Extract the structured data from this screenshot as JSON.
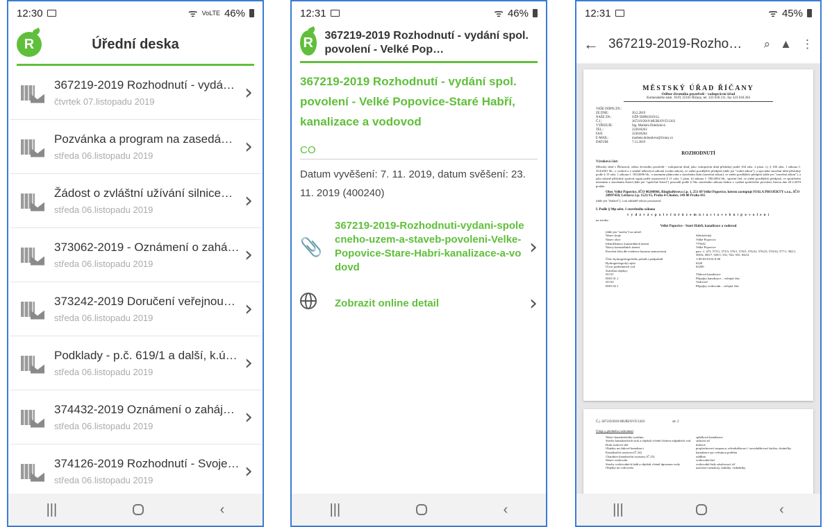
{
  "phone1": {
    "status": {
      "time": "12:30",
      "battery": "46%",
      "signal": "VoLTE"
    },
    "header_title": "Úřední deska",
    "logo_letter": "R",
    "items": [
      {
        "title": "367219-2019 Rozhodnutí - vydá…",
        "date": "čtvrtek 07.listopadu 2019"
      },
      {
        "title": "Pozvánka a program na zasedá…",
        "date": "středa 06.listopadu 2019"
      },
      {
        "title": "Žádost o zvláštní užívání silnice…",
        "date": "středa 06.listopadu 2019"
      },
      {
        "title": "373062-2019 - Oznámení o zahá…",
        "date": "středa 06.listopadu 2019"
      },
      {
        "title": "373242-2019 Doručení veřejnou…",
        "date": "středa 06.listopadu 2019"
      },
      {
        "title": "Podklady - p.č. 619/1 a další, k.ú…",
        "date": "středa 06.listopadu 2019"
      },
      {
        "title": "374432-2019 Oznámení o zaháj…",
        "date": "středa 06.listopadu 2019"
      },
      {
        "title": "374126-2019 Rozhodnutí - Svoje…",
        "date": "středa 06.listopadu 2019"
      }
    ]
  },
  "phone2": {
    "status": {
      "time": "12:31",
      "battery": "46%"
    },
    "logo_letter": "R",
    "header_title": "367219-2019 Rozhodnutí - vydání spol. povolení - Velké Pop…",
    "doc_title": "367219-2019 Rozhodnutí - vydání spol. povolení - Velké Popovice-Staré Habří, kanalizace a vodovod",
    "section_label": "CO",
    "dates_text": "Datum vyvěšení: 7. 11. 2019, datum svěšení: 23. 11. 2019  (400240)",
    "attachment": "367219-2019-Rozhodnuti-vydani-spolecneho-uzem-a-staveb-povoleni-Velke-Popovice-Stare-Habri-kanalizace-a-vodovd",
    "online_detail": "Zobrazit online detail"
  },
  "phone3": {
    "status": {
      "time": "12:31",
      "battery": "45%"
    },
    "title": "367219-2019-Rozho…",
    "doc": {
      "office": "MĚSTSKÝ ÚŘAD ŘÍČANY",
      "department": "Odbor životního prostředí - vodoprávní úřad",
      "address": "Komenského nám. 1619, 25101 Říčany, tel. 323 618 211, fax 323 618 264",
      "meta": [
        [
          "VAŠE DOPIS ZN.:",
          ""
        ],
        [
          "ZE DNE:",
          "20.2.2019"
        ],
        [
          "NAŠE ZN.:",
          "OŽP-50898/2019-Li"
        ],
        [
          "Č.J.:",
          "367219/2019-MURI/OVÚ/1263"
        ],
        [
          "VYŘIZUJE:",
          "Ing. Markéta Doležalová"
        ],
        [
          "TEL.:",
          "323618263"
        ],
        [
          "FAX:",
          "323618264"
        ],
        [
          "E-MAIL:",
          "marketa.dolezalova@ricany.cz"
        ],
        [
          "DATUM:",
          "7.11.2019"
        ]
      ],
      "heading": "ROZHODNUTÍ",
      "verdict_label": "Výroková část:",
      "verdict_text": "Městský úřad v Říčanech, odbor životního prostředí - vodoprávní úřad, jako vodoprávní úřad příslušný podle 104 odst. 2 písm. c), § 106 odst. 1 zákona č. 254/2001 Sb., o vodách a o změně některých zákonů (vodní zákon), ve znění pozdějších předpisů (dále jen \"vodní zákon\"), a speciální stavební úřad příslušný podle § 15 odst. 1 zákona č. 183/2006 Sb., o územním plánování a stavebním řádu (stavební zákon), ve znění pozdějších předpisů (dále jen \"stavební zákon\"), a jako místně příslušný správní orgán podle ustanovení § 11 odst. 1 písm. b) zákona č. 500/2004 Sb., správní řád, ve znění pozdějších předpisů, ve společném územním a stavebním řízení (dále jen \"společné řízení\") posoudil podle § 94o stavebního zákona žádost o vydání společného povolení, kterou dne 20.2.2019 podala",
      "applicant": "Obec Velké Popovice, IČO 00240966, Ringhofferova č.p. 1, 251 69 Velké Popovice, kterou zastupuje FIALA PROJEKTY s.r.o., IČO 28997450, Lečkova č.p. 1521/15, Praha 4-Chodov, 149 00 Praha 415",
      "applicant_tail": "(dále jen \"žadatel\"), a na základě tohoto posouzení:",
      "point1": "I.   Podle § 94p odst. 1 stavebního zákona",
      "point1_sub": "v y d á v á   s p o l e č n é   ú z e m n í   a   s t a v e b n í   p o v o l e n í",
      "na_stavbu": "na stavbu:",
      "stavba": "Velké Popovice - Staré Habří, kanalizace a vodovod",
      "grid": [
        [
          "(dále jen \"stavba\") na místě:",
          ""
        ],
        [
          "Název kraje",
          "Středočeský"
        ],
        [
          "Název obce",
          "Velké Popovice"
        ],
        [
          "Identifikátory katastrálních území",
          "779342"
        ],
        [
          "Názvy katastrálních území",
          "Velké Popovice"
        ],
        [
          "Parcelní čísla dle evidence katastru nemovitostí",
          "parc. č. 473, 573/1, 573/3, 576/1, 576/5, 576/22, 576/23, 576/34, 577/1, 582/1, 585/6, 585/7, 929/1, 931, 932, 935, 942/4"
        ],
        [
          "Číslo hydrogeologického pořadí a podpořadí",
          "1-09-03-0152-0-00"
        ],
        [
          "Hydrogeologický rajón",
          "6320"
        ],
        [
          "Útvar podzemních vod",
          "63200"
        ],
        [
          "Stavební objekty:",
          ""
        ],
        [
          "SO 01",
          "Tlaková kanalizace"
        ],
        [
          "DSO 01.1",
          "Přípojky kanalizace – veřejná část"
        ],
        [
          "SO 02",
          "Vodovod"
        ],
        [
          "DSO 02.1",
          "Přípojky vodovodu – veřejná část"
        ]
      ],
      "page2_ref": "Č.j. 367219/2019-MURI/OVÚ/1263",
      "page2_num": "str. 2",
      "page2_label": "Údaje o předmětu rozhodnutí",
      "page2_grid": [
        [
          "Název kanalizačního systému",
          "splašková kanalizace"
        ],
        [
          "Stavby kanalizačních stok a objektů včetně čistíren odpadních vod",
          "stoková síť"
        ],
        [
          "Druh stokové sítě",
          "tlaková"
        ],
        [
          "Objekty na tlakové kanalizaci",
          "proplachovací soupravа, odvzdušňovací / zavzdušňovací šachta, chráničky"
        ],
        [
          "Kanalizační soustava (Č 24)",
          "kanalizace pro veřejnou potřebu"
        ],
        [
          "Charakter kanalizační soustavy (Č 25)",
          "oddílná"
        ],
        [
          "Název vodovodu",
          "vodovodní řad"
        ],
        [
          "Stavby vodovodních řadů a objektů včetně úpravnen vody",
          "vodovodní řady zásobovací síť"
        ],
        [
          "Objekty na vodovodu",
          "uzavírací armatury, kalníky, vzdušníky,"
        ]
      ]
    }
  }
}
